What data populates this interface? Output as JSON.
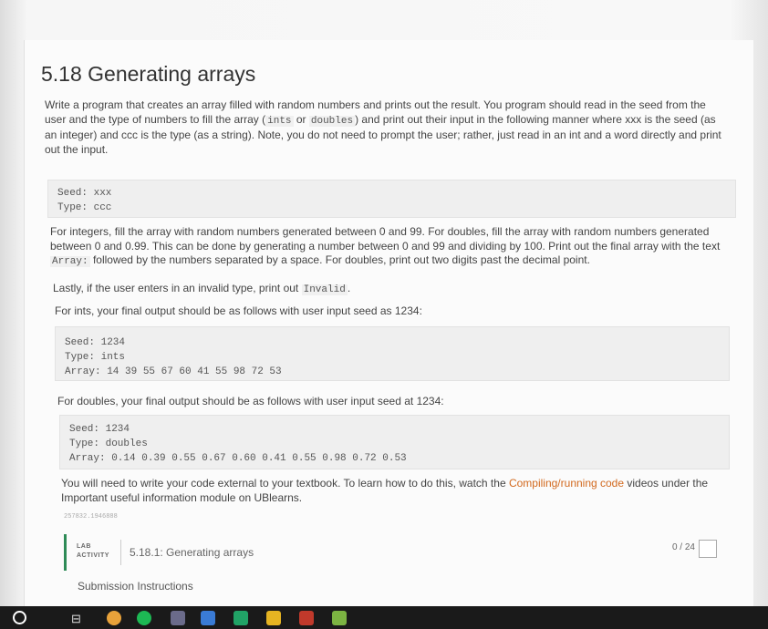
{
  "title": "5.18 Generating arrays",
  "intro": {
    "p1": "Write a program that creates an array filled with random numbers and prints out the result. You program should read in the seed from the",
    "p2a": "user and the type of numbers to fill the array (",
    "p2_code1": "ints",
    "p2_or": " or ",
    "p2_code2": "doubles",
    "p2b": ") and print out their input in the following manner where xxx is the seed (as",
    "p3": "an integer) and ccc is the type (as a string). Note, you do not need to prompt the user; rather, just read in an int and a word directly and print",
    "p4": "out the input."
  },
  "format_box": {
    "line1": "Seed: xxx",
    "line2": "Type: ccc"
  },
  "rules": {
    "l1": "For integers, fill the array with random numbers generated between 0 and 99. For doubles, fill the array with random numbers generated",
    "l2": "between 0 and 0.99. This can be done by generating a number between 0 and 99 and dividing by 100. Print out the final array with the text",
    "l3_code": "Array:",
    "l3": " followed by the numbers separated by a space. For doubles, print out two digits past the decimal point.",
    "invalid_a": "Lastly, if the user enters in an invalid type, print out ",
    "invalid_code": "Invalid",
    "invalid_b": ".",
    "ints_intro": "For ints, your final output should be as follows with user input seed as 1234:"
  },
  "ints_box": {
    "line1": "Seed: 1234",
    "line2": "Type: ints",
    "line3": "Array: 14 39 55 67 60 41 55 98 72 53"
  },
  "doubles_intro": "For doubles, your final output should be as follows with user input seed at 1234:",
  "doubles_box": {
    "line1": "Seed: 1234",
    "line2": "Type: doubles",
    "line3": "Array: 0.14 0.39 0.55 0.67 0.60 0.41 0.55 0.98 0.72 0.53"
  },
  "external": {
    "a": "You will need to write your code external to your textbook. To learn how to do this, watch the ",
    "link": "Compiling/running code",
    "b": " videos under the",
    "c": "Important useful information module on UBlearns."
  },
  "small_id": "257832.1946888",
  "lab": {
    "tag1": "LAB",
    "tag2": "ACTIVITY",
    "title": "5.18.1: Generating arrays",
    "score": "0 / 24"
  },
  "submission": "Submission Instructions",
  "colors": {
    "accent_green": "#2e8b57",
    "link": "#d2691e"
  }
}
